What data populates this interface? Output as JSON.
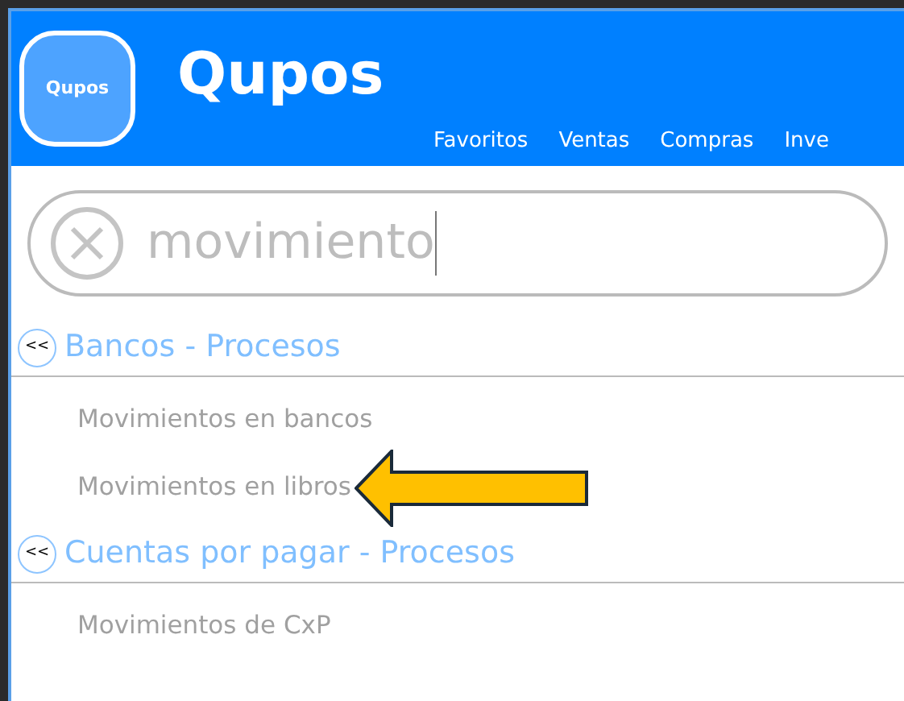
{
  "logo": {
    "badge_text": "Qupos",
    "wordmark": "Qupos"
  },
  "menu": [
    {
      "label": "Favoritos"
    },
    {
      "label": "Ventas"
    },
    {
      "label": "Compras"
    },
    {
      "label": "Inve"
    }
  ],
  "search": {
    "value": "movimiento",
    "focused": true
  },
  "sections": [
    {
      "toggle": "<<",
      "title": "Bancos - Procesos",
      "items": [
        {
          "label": "Movimientos en bancos",
          "pointed": false
        },
        {
          "label": "Movimientos en libros",
          "pointed": true
        }
      ]
    },
    {
      "toggle": "<<",
      "title": "Cuentas por pagar - Procesos",
      "items": [
        {
          "label": "Movimientos de CxP",
          "pointed": false
        }
      ]
    }
  ]
}
